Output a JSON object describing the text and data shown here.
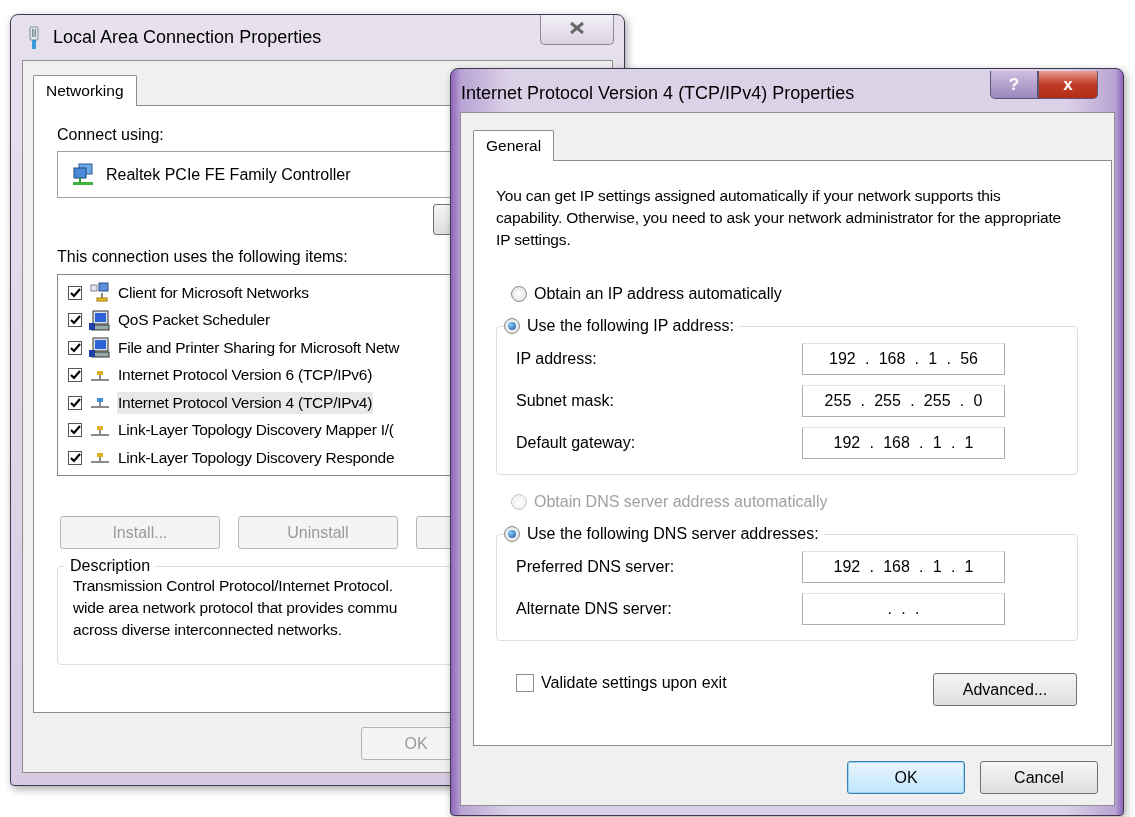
{
  "back_window": {
    "title": "Local Area Connection Properties",
    "tabs": [
      {
        "label": "Networking",
        "selected": true
      }
    ],
    "connect_using_label": "Connect using:",
    "adapter": "Realtek PCIe FE Family Controller",
    "items_label": "This connection uses the following items:",
    "items": [
      {
        "label": "Client for Microsoft Networks",
        "kind": "client",
        "checked": true,
        "selected": false
      },
      {
        "label": "QoS Packet Scheduler",
        "kind": "service",
        "checked": true,
        "selected": false
      },
      {
        "label": "File and Printer Sharing for Microsoft Netw",
        "kind": "service",
        "checked": true,
        "selected": false
      },
      {
        "label": "Internet Protocol Version 6 (TCP/IPv6)",
        "kind": "protocol",
        "checked": true,
        "selected": false
      },
      {
        "label": "Internet Protocol Version 4 (TCP/IPv4)",
        "kind": "protocol",
        "checked": true,
        "selected": true
      },
      {
        "label": "Link-Layer Topology Discovery Mapper I/(",
        "kind": "protocol",
        "checked": true,
        "selected": false
      },
      {
        "label": "Link-Layer Topology Discovery Responde",
        "kind": "protocol",
        "checked": true,
        "selected": false
      }
    ],
    "buttons": [
      {
        "label": "Install...",
        "disabled": true
      },
      {
        "label": "Uninstall",
        "disabled": true
      }
    ],
    "description": {
      "title": "Description",
      "text": "Transmission Control Protocol/Internet Protocol.\nwide area network protocol that provides commu\nacross diverse interconnected networks."
    },
    "footer_buttons": [
      {
        "label": "OK",
        "disabled": true
      }
    ]
  },
  "front_window": {
    "title": "Internet Protocol Version 4 (TCP/IPv4) Properties",
    "title_buttons": [
      "?",
      "x"
    ],
    "tabs": [
      {
        "label": "General",
        "selected": true
      }
    ],
    "intro": "You can get IP settings assigned automatically if your network supports this capability. Otherwise, you need to ask your network administrator for the appropriate IP settings.",
    "ip_options": [
      {
        "label": "Obtain an IP address automatically",
        "selected": false,
        "disabled": false
      },
      {
        "label": "Use the following IP address:",
        "selected": true,
        "disabled": false,
        "fields": [
          {
            "label": "IP address:",
            "value": "192 . 168 . 1 . 56"
          },
          {
            "label": "Subnet mask:",
            "value": "255 . 255 . 255 . 0"
          },
          {
            "label": "Default gateway:",
            "value": "192 . 168 . 1 . 1"
          }
        ]
      }
    ],
    "dns_options": [
      {
        "label": "Obtain DNS server address automatically",
        "selected": false,
        "disabled": true
      },
      {
        "label": "Use the following DNS server addresses:",
        "selected": true,
        "disabled": false,
        "fields": [
          {
            "label": "Preferred DNS server:",
            "value": "192 . 168 . 1 . 1"
          },
          {
            "label": "Alternate DNS server:",
            "value": ". . ."
          }
        ]
      }
    ],
    "validate": {
      "label": "Validate settings upon exit",
      "checked": false
    },
    "advanced_button": "Advanced...",
    "footer_buttons": [
      {
        "label": "OK",
        "default": true
      },
      {
        "label": "Cancel",
        "default": false
      }
    ]
  }
}
